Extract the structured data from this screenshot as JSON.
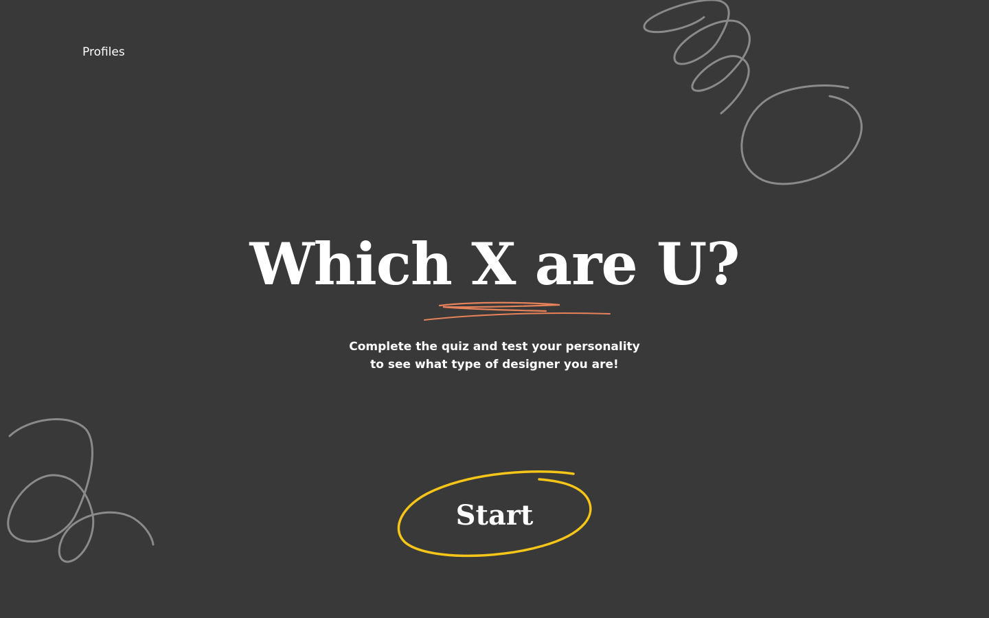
{
  "nav": {
    "profiles_label": "Profiles"
  },
  "hero": {
    "headline": "Which X are U?",
    "subtitle_line1": "Complete the quiz and test your personality",
    "subtitle_line2": "to see what type of designer you are!"
  },
  "actions": {
    "start_label": "Start"
  },
  "colors": {
    "background": "#393939",
    "text": "#ffffff",
    "underline_accent": "#e8825a",
    "start_ring": "#f5c518",
    "squiggle": "#8a8a8a"
  }
}
